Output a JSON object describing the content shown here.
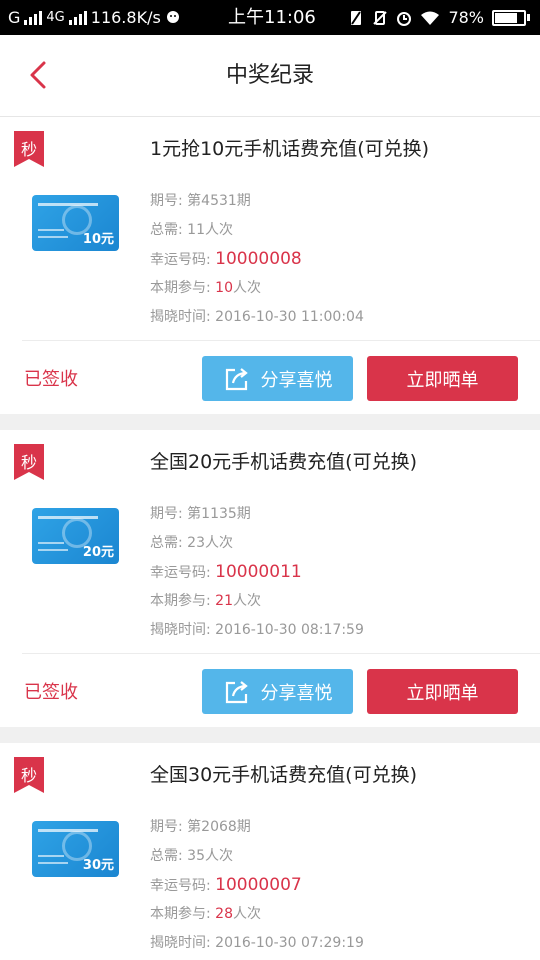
{
  "status_bar": {
    "carrier1": "G",
    "network": "4G",
    "speed": "116.8K/s",
    "time": "上午11:06",
    "battery_percent": "78%",
    "battery_level": 0.78
  },
  "header": {
    "title": "中奖纪录"
  },
  "labels": {
    "period_prefix": "期号: ",
    "need_prefix": "总需: ",
    "lucky_prefix": "幸运号码: ",
    "join_prefix": "本期参与: ",
    "reveal_prefix": "揭晓时间: ",
    "times_suffix": "人次",
    "badge": "秒"
  },
  "records": [
    {
      "title": "1元抢10元手机话费充值(可兑换)",
      "card_amount": "10元",
      "period": "第4531期",
      "need": "11人次",
      "lucky_number": "10000008",
      "join_count": "10",
      "reveal_time": "2016-10-30 11:00:04",
      "status": "已签收",
      "share_label": "分享喜悦",
      "show_label": "立即晒单"
    },
    {
      "title": "全国20元手机话费充值(可兑换)",
      "card_amount": "20元",
      "period": "第1135期",
      "need": "23人次",
      "lucky_number": "10000011",
      "join_count": "21",
      "reveal_time": "2016-10-30 08:17:59",
      "status": "已签收",
      "share_label": "分享喜悦",
      "show_label": "立即晒单"
    },
    {
      "title": "全国30元手机话费充值(可兑换)",
      "card_amount": "30元",
      "period": "第2068期",
      "need": "35人次",
      "lucky_number": "10000007",
      "join_count": "28",
      "reveal_time": "2016-10-30 07:29:19"
    }
  ],
  "colors": {
    "accent_red": "#d9344a",
    "share_blue": "#54b6ea",
    "muted_text": "#999999"
  }
}
